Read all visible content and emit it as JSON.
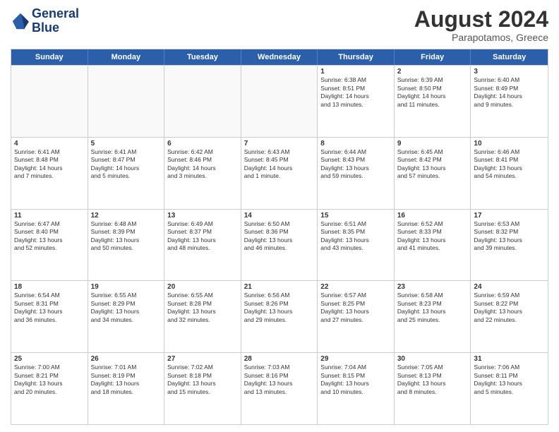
{
  "header": {
    "logo_line1": "General",
    "logo_line2": "Blue",
    "month_year": "August 2024",
    "location": "Parapotamos, Greece"
  },
  "weekdays": [
    "Sunday",
    "Monday",
    "Tuesday",
    "Wednesday",
    "Thursday",
    "Friday",
    "Saturday"
  ],
  "rows": [
    [
      {
        "day": "",
        "info": ""
      },
      {
        "day": "",
        "info": ""
      },
      {
        "day": "",
        "info": ""
      },
      {
        "day": "",
        "info": ""
      },
      {
        "day": "1",
        "info": "Sunrise: 6:38 AM\nSunset: 8:51 PM\nDaylight: 14 hours\nand 13 minutes."
      },
      {
        "day": "2",
        "info": "Sunrise: 6:39 AM\nSunset: 8:50 PM\nDaylight: 14 hours\nand 11 minutes."
      },
      {
        "day": "3",
        "info": "Sunrise: 6:40 AM\nSunset: 8:49 PM\nDaylight: 14 hours\nand 9 minutes."
      }
    ],
    [
      {
        "day": "4",
        "info": "Sunrise: 6:41 AM\nSunset: 8:48 PM\nDaylight: 14 hours\nand 7 minutes."
      },
      {
        "day": "5",
        "info": "Sunrise: 6:41 AM\nSunset: 8:47 PM\nDaylight: 14 hours\nand 5 minutes."
      },
      {
        "day": "6",
        "info": "Sunrise: 6:42 AM\nSunset: 8:46 PM\nDaylight: 14 hours\nand 3 minutes."
      },
      {
        "day": "7",
        "info": "Sunrise: 6:43 AM\nSunset: 8:45 PM\nDaylight: 14 hours\nand 1 minute."
      },
      {
        "day": "8",
        "info": "Sunrise: 6:44 AM\nSunset: 8:43 PM\nDaylight: 13 hours\nand 59 minutes."
      },
      {
        "day": "9",
        "info": "Sunrise: 6:45 AM\nSunset: 8:42 PM\nDaylight: 13 hours\nand 57 minutes."
      },
      {
        "day": "10",
        "info": "Sunrise: 6:46 AM\nSunset: 8:41 PM\nDaylight: 13 hours\nand 54 minutes."
      }
    ],
    [
      {
        "day": "11",
        "info": "Sunrise: 6:47 AM\nSunset: 8:40 PM\nDaylight: 13 hours\nand 52 minutes."
      },
      {
        "day": "12",
        "info": "Sunrise: 6:48 AM\nSunset: 8:39 PM\nDaylight: 13 hours\nand 50 minutes."
      },
      {
        "day": "13",
        "info": "Sunrise: 6:49 AM\nSunset: 8:37 PM\nDaylight: 13 hours\nand 48 minutes."
      },
      {
        "day": "14",
        "info": "Sunrise: 6:50 AM\nSunset: 8:36 PM\nDaylight: 13 hours\nand 46 minutes."
      },
      {
        "day": "15",
        "info": "Sunrise: 6:51 AM\nSunset: 8:35 PM\nDaylight: 13 hours\nand 43 minutes."
      },
      {
        "day": "16",
        "info": "Sunrise: 6:52 AM\nSunset: 8:33 PM\nDaylight: 13 hours\nand 41 minutes."
      },
      {
        "day": "17",
        "info": "Sunrise: 6:53 AM\nSunset: 8:32 PM\nDaylight: 13 hours\nand 39 minutes."
      }
    ],
    [
      {
        "day": "18",
        "info": "Sunrise: 6:54 AM\nSunset: 8:31 PM\nDaylight: 13 hours\nand 36 minutes."
      },
      {
        "day": "19",
        "info": "Sunrise: 6:55 AM\nSunset: 8:29 PM\nDaylight: 13 hours\nand 34 minutes."
      },
      {
        "day": "20",
        "info": "Sunrise: 6:55 AM\nSunset: 8:28 PM\nDaylight: 13 hours\nand 32 minutes."
      },
      {
        "day": "21",
        "info": "Sunrise: 6:56 AM\nSunset: 8:26 PM\nDaylight: 13 hours\nand 29 minutes."
      },
      {
        "day": "22",
        "info": "Sunrise: 6:57 AM\nSunset: 8:25 PM\nDaylight: 13 hours\nand 27 minutes."
      },
      {
        "day": "23",
        "info": "Sunrise: 6:58 AM\nSunset: 8:23 PM\nDaylight: 13 hours\nand 25 minutes."
      },
      {
        "day": "24",
        "info": "Sunrise: 6:59 AM\nSunset: 8:22 PM\nDaylight: 13 hours\nand 22 minutes."
      }
    ],
    [
      {
        "day": "25",
        "info": "Sunrise: 7:00 AM\nSunset: 8:21 PM\nDaylight: 13 hours\nand 20 minutes."
      },
      {
        "day": "26",
        "info": "Sunrise: 7:01 AM\nSunset: 8:19 PM\nDaylight: 13 hours\nand 18 minutes."
      },
      {
        "day": "27",
        "info": "Sunrise: 7:02 AM\nSunset: 8:18 PM\nDaylight: 13 hours\nand 15 minutes."
      },
      {
        "day": "28",
        "info": "Sunrise: 7:03 AM\nSunset: 8:16 PM\nDaylight: 13 hours\nand 13 minutes."
      },
      {
        "day": "29",
        "info": "Sunrise: 7:04 AM\nSunset: 8:15 PM\nDaylight: 13 hours\nand 10 minutes."
      },
      {
        "day": "30",
        "info": "Sunrise: 7:05 AM\nSunset: 8:13 PM\nDaylight: 13 hours\nand 8 minutes."
      },
      {
        "day": "31",
        "info": "Sunrise: 7:06 AM\nSunset: 8:11 PM\nDaylight: 13 hours\nand 5 minutes."
      }
    ]
  ]
}
